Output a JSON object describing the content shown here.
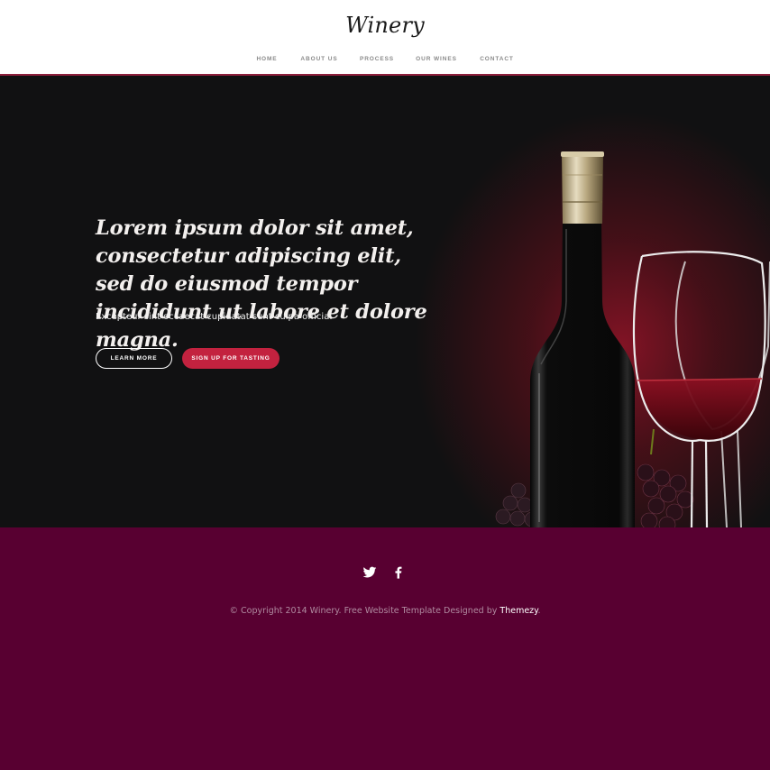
{
  "header": {
    "logo": "Winery",
    "nav": [
      {
        "label": "HOME"
      },
      {
        "label": "ABOUT US"
      },
      {
        "label": "PROCESS"
      },
      {
        "label": "OUR WINES"
      },
      {
        "label": "CONTACT"
      }
    ]
  },
  "hero": {
    "headline": "Lorem ipsum dolor sit amet, consectetur adipiscing elit, sed do eiusmod tempor incididunt ut labore et dolore magna.",
    "subtext": "Excepteur sint occaecat cupidatat sunt culpa officia.",
    "learn_more": "LEARN MORE",
    "sign_up": "SIGN UP FOR TASTING"
  },
  "footer": {
    "social": [
      {
        "icon": "twitter-icon"
      },
      {
        "icon": "facebook-icon"
      }
    ],
    "copyright_prefix": "© Copyright 2014 Winery. Free Website Template Designed by ",
    "copyright_link": "Themezy",
    "copyright_suffix": "."
  },
  "colors": {
    "accent": "#c3223f",
    "nav_border": "#8e1f3c",
    "hero_bg": "#111112",
    "footer_bg": "#580031"
  }
}
